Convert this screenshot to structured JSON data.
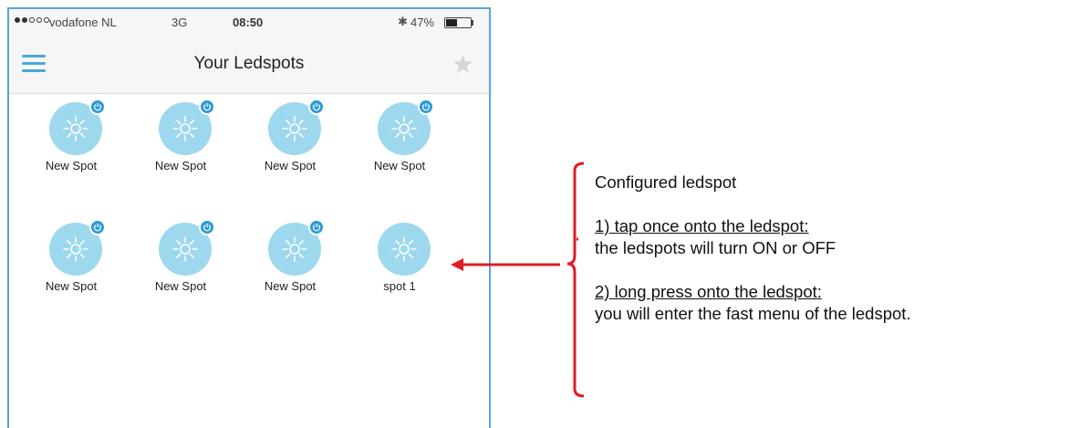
{
  "status_bar": {
    "carrier": "vodafone NL",
    "network": "3G",
    "time": "08:50",
    "battery": "47%",
    "battery_level_percent": 47,
    "signal_bars_filled": 2,
    "signal_bars_total": 5
  },
  "nav": {
    "title": "Your Ledspots",
    "menu_icon": "hamburger-menu-icon",
    "favorite_icon": "star-icon"
  },
  "colors": {
    "accent": "#4aa7da",
    "bulb": "#9ed8ee",
    "badge": "#2d9bd6",
    "frame": "#5aa5d8",
    "annotation_line": "#e31b23"
  },
  "spots": [
    {
      "label": "New Spot",
      "has_badge": true
    },
    {
      "label": "New Spot",
      "has_badge": true
    },
    {
      "label": "New Spot",
      "has_badge": true
    },
    {
      "label": "New Spot",
      "has_badge": true
    },
    {
      "label": "New Spot",
      "has_badge": true
    },
    {
      "label": "New Spot",
      "has_badge": true
    },
    {
      "label": "New Spot",
      "has_badge": true
    },
    {
      "label": "spot 1",
      "has_badge": false
    }
  ],
  "annotation": {
    "heading": "Configured ledspot",
    "step1_title": "1) tap once onto the ledspot:",
    "step1_text": "the ledspots will turn ON or OFF",
    "step2_title": "2) long press onto the ledspot:",
    "step2_text": "you will enter the fast menu of the ledspot."
  }
}
